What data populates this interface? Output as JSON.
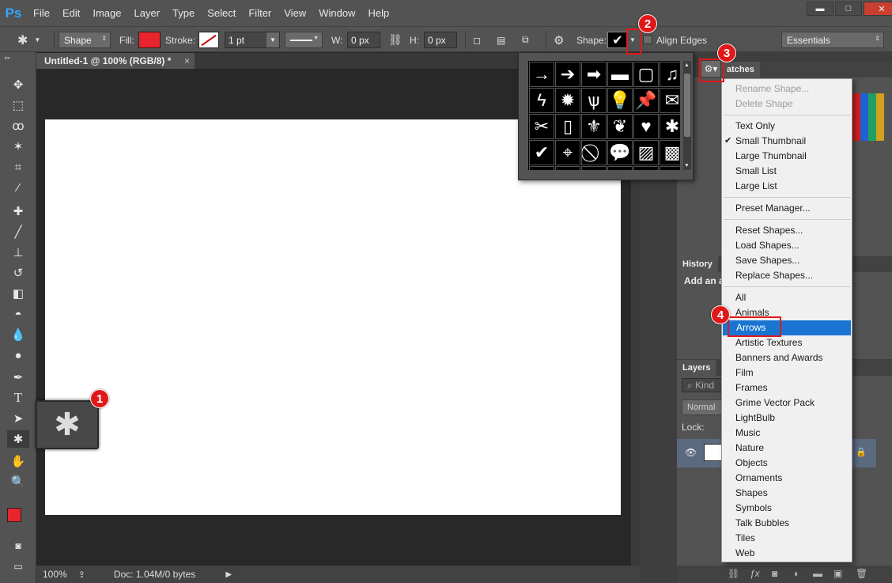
{
  "app": {
    "logo": "Ps"
  },
  "menu": [
    "File",
    "Edit",
    "Image",
    "Layer",
    "Type",
    "Select",
    "Filter",
    "View",
    "Window",
    "Help"
  ],
  "window_controls": {
    "minimize": "▬",
    "maximize": "□",
    "close": "✕"
  },
  "options": {
    "mode": "Shape",
    "fill_label": "Fill:",
    "stroke_label": "Stroke:",
    "stroke_width": "1 pt",
    "w_label": "W:",
    "w_value": "0 px",
    "h_label": "H:",
    "h_value": "0 px",
    "shape_label": "Shape:",
    "align_edges": "Align Edges",
    "workspace": "Essentials",
    "fill_color": "#e8242c"
  },
  "document": {
    "tab_title": "Untitled-1 @ 100% (RGB/8) *",
    "close": "×"
  },
  "status": {
    "zoom": "100%",
    "doc_info": "Doc: 1.04M/0 bytes"
  },
  "panels": {
    "swatches_tab": "atches",
    "history_tab": "History",
    "history_text": "Add an a",
    "layers_tab": "Layers",
    "layers_kind": "Kind",
    "layers_blend": "Normal",
    "layers_lock": "Lock:"
  },
  "shape_menu": {
    "items": [
      {
        "label": "Rename Shape...",
        "disabled": true
      },
      {
        "label": "Delete Shape",
        "disabled": true
      },
      {
        "label": "Text Only"
      },
      {
        "label": "Small Thumbnail",
        "checked": true
      },
      {
        "label": "Large Thumbnail"
      },
      {
        "label": "Small List"
      },
      {
        "label": "Large List"
      },
      {
        "label": "Preset Manager..."
      },
      {
        "label": "Reset Shapes..."
      },
      {
        "label": "Load Shapes..."
      },
      {
        "label": "Save Shapes..."
      },
      {
        "label": "Replace Shapes..."
      },
      {
        "label": "All"
      },
      {
        "label": "Animals"
      },
      {
        "label": "Arrows",
        "highlighted": true
      },
      {
        "label": "Artistic Textures"
      },
      {
        "label": "Banners and Awards"
      },
      {
        "label": "Film"
      },
      {
        "label": "Frames"
      },
      {
        "label": "Grime Vector Pack"
      },
      {
        "label": "LightBulb"
      },
      {
        "label": "Music"
      },
      {
        "label": "Nature"
      },
      {
        "label": "Objects"
      },
      {
        "label": "Ornaments"
      },
      {
        "label": "Shapes"
      },
      {
        "label": "Symbols"
      },
      {
        "label": "Talk Bubbles"
      },
      {
        "label": "Tiles"
      },
      {
        "label": "Web"
      }
    ],
    "check_mark": "✔"
  },
  "callouts": [
    "1",
    "2",
    "3",
    "4"
  ],
  "accent_color": "#e01818",
  "highlight_color": "#1a75d2"
}
